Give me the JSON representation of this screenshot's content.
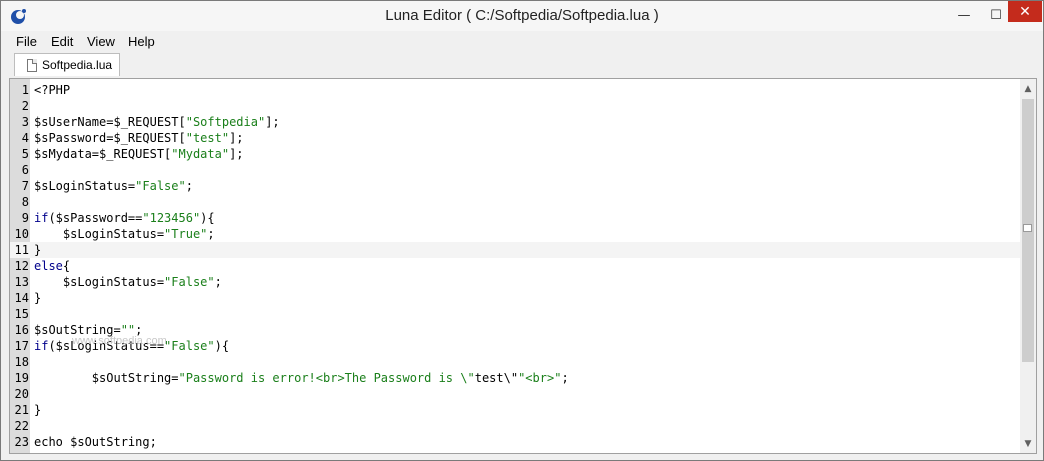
{
  "window": {
    "title": "Luna Editor ( C:/Softpedia/Softpedia.lua )",
    "minimize_glyph": "—",
    "maximize_glyph": "☐",
    "close_glyph": "✕"
  },
  "menu": {
    "items": [
      "File",
      "Edit",
      "View",
      "Help"
    ]
  },
  "tabs": [
    {
      "label": "Softpedia.lua",
      "icon": "document-icon"
    }
  ],
  "editor": {
    "current_line": 11,
    "lines": [
      {
        "n": "1",
        "tokens": [
          {
            "t": "<?PHP",
            "c": "plain"
          }
        ]
      },
      {
        "n": "2",
        "tokens": []
      },
      {
        "n": "3",
        "tokens": [
          {
            "t": "$sUserName=$_REQUEST[",
            "c": "plain"
          },
          {
            "t": "\"Softpedia\"",
            "c": "str"
          },
          {
            "t": "];",
            "c": "plain"
          }
        ]
      },
      {
        "n": "4",
        "tokens": [
          {
            "t": "$sPassword=$_REQUEST[",
            "c": "plain"
          },
          {
            "t": "\"test\"",
            "c": "str"
          },
          {
            "t": "];",
            "c": "plain"
          }
        ]
      },
      {
        "n": "5",
        "tokens": [
          {
            "t": "$sMydata=$_REQUEST[",
            "c": "plain"
          },
          {
            "t": "\"Mydata\"",
            "c": "str"
          },
          {
            "t": "];",
            "c": "plain"
          }
        ]
      },
      {
        "n": "6",
        "tokens": []
      },
      {
        "n": "7",
        "tokens": [
          {
            "t": "$sLoginStatus=",
            "c": "plain"
          },
          {
            "t": "\"False\"",
            "c": "str"
          },
          {
            "t": ";",
            "c": "plain"
          }
        ]
      },
      {
        "n": "8",
        "tokens": []
      },
      {
        "n": "9",
        "tokens": [
          {
            "t": "if",
            "c": "kw"
          },
          {
            "t": "($sPassword==",
            "c": "plain"
          },
          {
            "t": "\"123456\"",
            "c": "str"
          },
          {
            "t": "){",
            "c": "plain"
          }
        ]
      },
      {
        "n": "10",
        "tokens": [
          {
            "t": "    $sLoginStatus=",
            "c": "plain"
          },
          {
            "t": "\"True\"",
            "c": "str"
          },
          {
            "t": ";",
            "c": "plain"
          }
        ]
      },
      {
        "n": "11",
        "tokens": [
          {
            "t": "}",
            "c": "plain"
          }
        ]
      },
      {
        "n": "12",
        "tokens": [
          {
            "t": "else",
            "c": "kw"
          },
          {
            "t": "{",
            "c": "plain"
          }
        ]
      },
      {
        "n": "13",
        "tokens": [
          {
            "t": "    $sLoginStatus=",
            "c": "plain"
          },
          {
            "t": "\"False\"",
            "c": "str"
          },
          {
            "t": ";",
            "c": "plain"
          }
        ]
      },
      {
        "n": "14",
        "tokens": [
          {
            "t": "}",
            "c": "plain"
          }
        ]
      },
      {
        "n": "15",
        "tokens": []
      },
      {
        "n": "16",
        "tokens": [
          {
            "t": "$sOutString=",
            "c": "plain"
          },
          {
            "t": "\"\"",
            "c": "str"
          },
          {
            "t": ";",
            "c": "plain"
          }
        ]
      },
      {
        "n": "17",
        "tokens": [
          {
            "t": "if",
            "c": "kw"
          },
          {
            "t": "($sLoginStatus==",
            "c": "plain"
          },
          {
            "t": "\"False\"",
            "c": "str"
          },
          {
            "t": "){",
            "c": "plain"
          }
        ]
      },
      {
        "n": "18",
        "tokens": []
      },
      {
        "n": "19",
        "tokens": [
          {
            "t": "        $sOutString=",
            "c": "plain"
          },
          {
            "t": "\"Password is error!<br>The Password is \\\"",
            "c": "str"
          },
          {
            "t": "test\\\"",
            "c": "plain"
          },
          {
            "t": "\"<br>\"",
            "c": "str"
          },
          {
            "t": ";",
            "c": "plain"
          }
        ]
      },
      {
        "n": "20",
        "tokens": []
      },
      {
        "n": "21",
        "tokens": [
          {
            "t": "}",
            "c": "plain"
          }
        ]
      },
      {
        "n": "22",
        "tokens": []
      },
      {
        "n": "23",
        "tokens": [
          {
            "t": "echo $sOutString;",
            "c": "plain"
          }
        ]
      }
    ]
  },
  "scrollbar": {
    "up_glyph": "▲",
    "down_glyph": "▼"
  },
  "watermark": "www.softpedia.com",
  "colors": {
    "keyword": "#00008b",
    "string": "#1a7f1a",
    "gutter": "#dcdcdc",
    "close_button": "#c42b1c"
  }
}
